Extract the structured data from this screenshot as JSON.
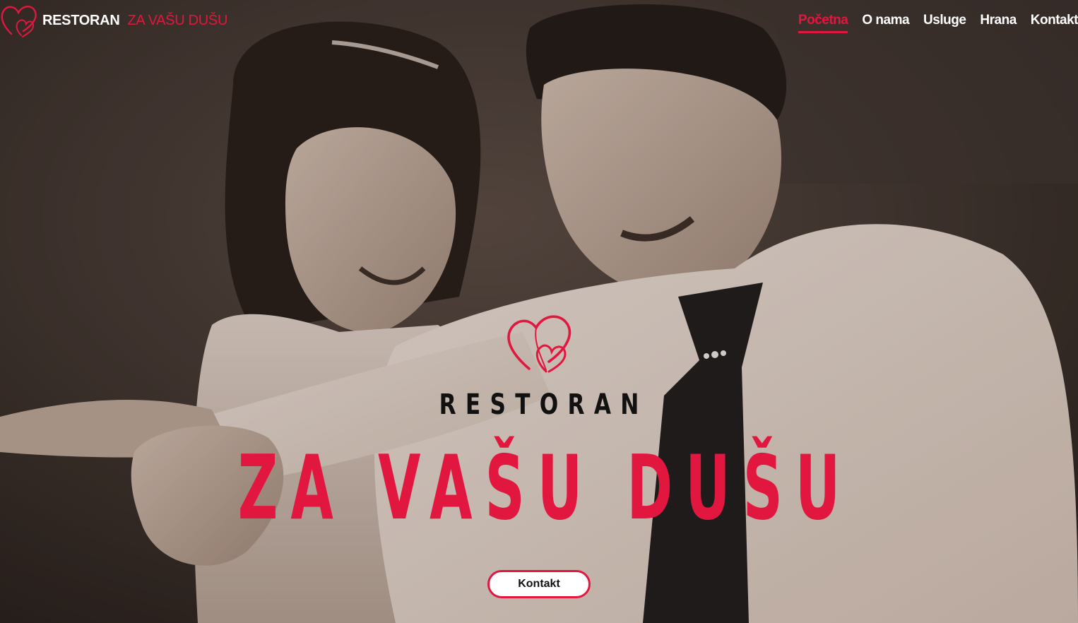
{
  "header": {
    "logo": {
      "icon": "double-heart-icon",
      "name": "RESTORAN",
      "accent": "ZA VAŠU DUŠU"
    },
    "nav": [
      {
        "label": "Početna",
        "active": true
      },
      {
        "label": "O nama",
        "active": false
      },
      {
        "label": "Usluge",
        "active": false
      },
      {
        "label": "Hrana",
        "active": false
      },
      {
        "label": "Kontakt",
        "active": false
      }
    ]
  },
  "hero": {
    "photo": "black-and-white wedding couple dancing photo",
    "icon": "double-heart-icon",
    "tagline": "RESTORAN",
    "title": "ZA VAŠU DUŠU",
    "button_label": "Kontakt"
  },
  "colors": {
    "accent": "#e2173f",
    "nav_text": "#ffffff",
    "tagline": "#111111",
    "button_bg": "#ffffff"
  }
}
